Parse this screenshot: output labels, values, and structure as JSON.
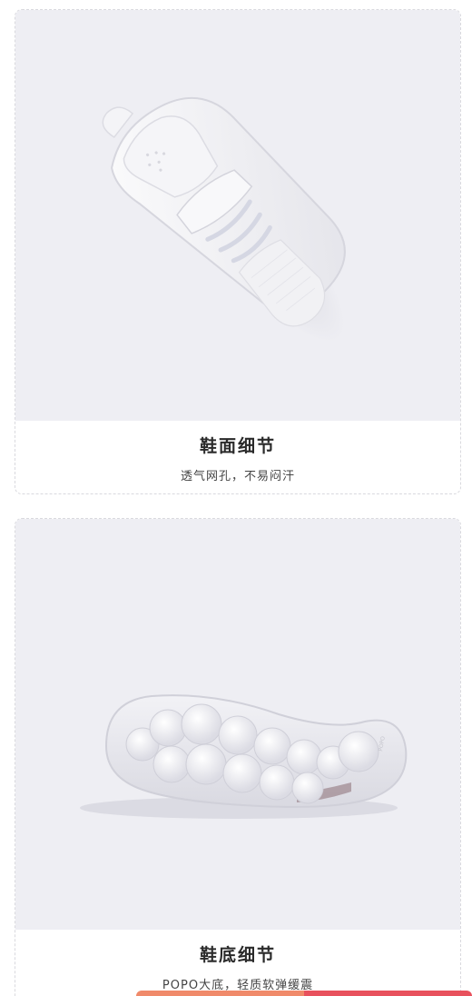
{
  "cards": [
    {
      "image_alt": "white sneaker upper top view",
      "title": "鞋面细节",
      "subtitle": "透气网孔，不易闷汗"
    },
    {
      "image_alt": "white sneaker outsole bottom view",
      "title": "鞋底细节",
      "subtitle": "POPO大底，轻质软弹缓震"
    }
  ],
  "colors": {
    "photo_bg": "#eeeef3",
    "bar_left": "#f08a6a",
    "bar_right": "#e8515d"
  }
}
